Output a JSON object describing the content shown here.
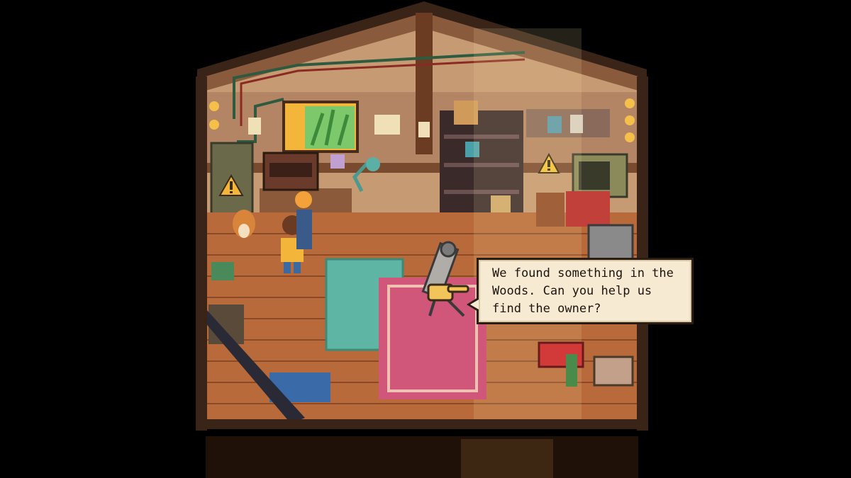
{
  "dialog": {
    "text": "We found something in the\nWoods. Can you help us\nfind the owner?"
  },
  "colors": {
    "background": "#000000",
    "floor": "#b86a3a",
    "wall": "#c9a07a",
    "rug_pink": "#d0577a",
    "rug_teal": "#5fb5a3",
    "dialog_bg": "#f6ebd2",
    "accent_yellow": "#f3b63a"
  },
  "scene": {
    "icons": [
      "warning-sign-icon",
      "telescope-icon",
      "pointer-hand-icon",
      "microwave-icon",
      "radio-icon",
      "toolbox-icon",
      "corgi-dog-icon"
    ]
  }
}
